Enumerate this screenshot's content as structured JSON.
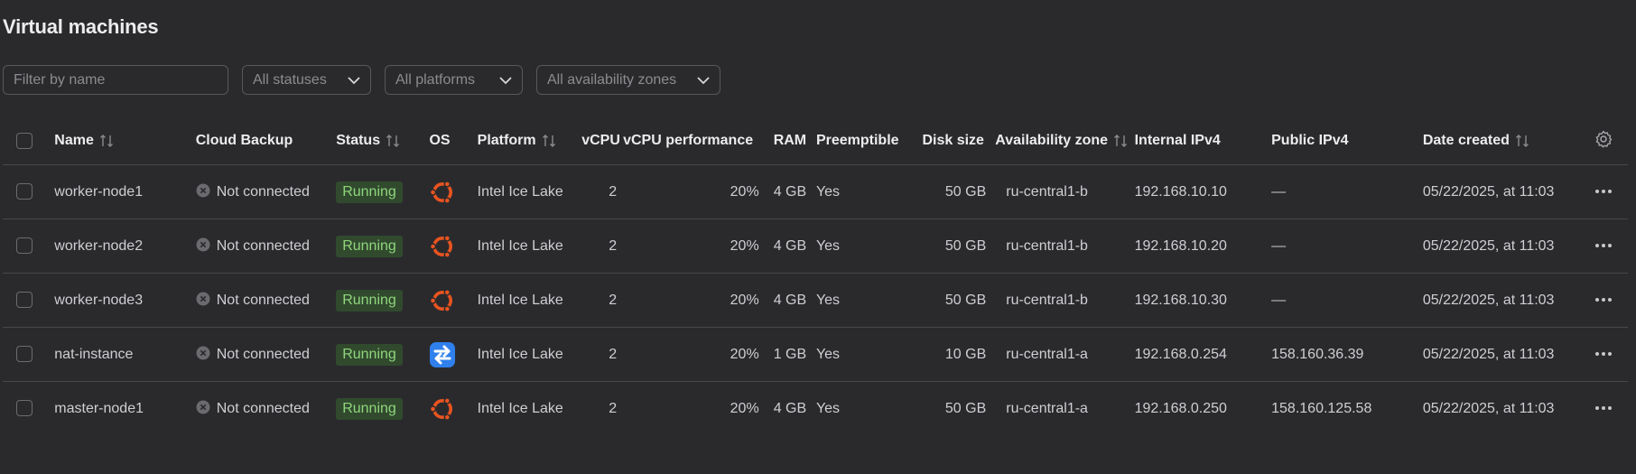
{
  "page": {
    "title": "Virtual machines"
  },
  "filters": {
    "name_placeholder": "Filter by name",
    "status": "All statuses",
    "platform": "All platforms",
    "zone": "All availability zones"
  },
  "columns": {
    "name": "Name",
    "backup": "Cloud Backup",
    "status": "Status",
    "os": "OS",
    "platform": "Platform",
    "vcpu": "vCPU",
    "perf": "vCPU performance",
    "ram": "RAM",
    "preemptible": "Preemptible",
    "disk": "Disk size",
    "zone": "Availability zone",
    "internal": "Internal IPv4",
    "public": "Public IPv4",
    "created": "Date created"
  },
  "rows": [
    {
      "name": "worker-node1",
      "backup": "Not connected",
      "status": "Running",
      "os": "ubuntu-icon",
      "platform": "Intel Ice Lake",
      "vcpu": "2",
      "perf": "20%",
      "ram": "4 GB",
      "preemptible": "Yes",
      "disk": "50 GB",
      "zone": "ru-central1-b",
      "internal": "192.168.10.10",
      "public": "—",
      "created": "05/22/2025, at 11:03"
    },
    {
      "name": "worker-node2",
      "backup": "Not connected",
      "status": "Running",
      "os": "ubuntu-icon",
      "platform": "Intel Ice Lake",
      "vcpu": "2",
      "perf": "20%",
      "ram": "4 GB",
      "preemptible": "Yes",
      "disk": "50 GB",
      "zone": "ru-central1-b",
      "internal": "192.168.10.20",
      "public": "—",
      "created": "05/22/2025, at 11:03"
    },
    {
      "name": "worker-node3",
      "backup": "Not connected",
      "status": "Running",
      "os": "ubuntu-icon",
      "platform": "Intel Ice Lake",
      "vcpu": "2",
      "perf": "20%",
      "ram": "4 GB",
      "preemptible": "Yes",
      "disk": "50 GB",
      "zone": "ru-central1-b",
      "internal": "192.168.10.30",
      "public": "—",
      "created": "05/22/2025, at 11:03"
    },
    {
      "name": "nat-instance",
      "backup": "Not connected",
      "status": "Running",
      "os": "nat-icon",
      "platform": "Intel Ice Lake",
      "vcpu": "2",
      "perf": "20%",
      "ram": "1 GB",
      "preemptible": "Yes",
      "disk": "10 GB",
      "zone": "ru-central1-a",
      "internal": "192.168.0.254",
      "public": "158.160.36.39",
      "created": "05/22/2025, at 11:03"
    },
    {
      "name": "master-node1",
      "backup": "Not connected",
      "status": "Running",
      "os": "ubuntu-icon",
      "platform": "Intel Ice Lake",
      "vcpu": "2",
      "perf": "20%",
      "ram": "4 GB",
      "preemptible": "Yes",
      "disk": "50 GB",
      "zone": "ru-central1-a",
      "internal": "192.168.0.250",
      "public": "158.160.125.58",
      "created": "05/22/2025, at 11:03"
    }
  ],
  "colors": {
    "background": "#2a2a2d",
    "running_badge_bg": "#314a2e",
    "running_badge_text": "#8fd57c",
    "ubuntu_orange": "#e95420",
    "nat_blue": "#2f80ed"
  }
}
